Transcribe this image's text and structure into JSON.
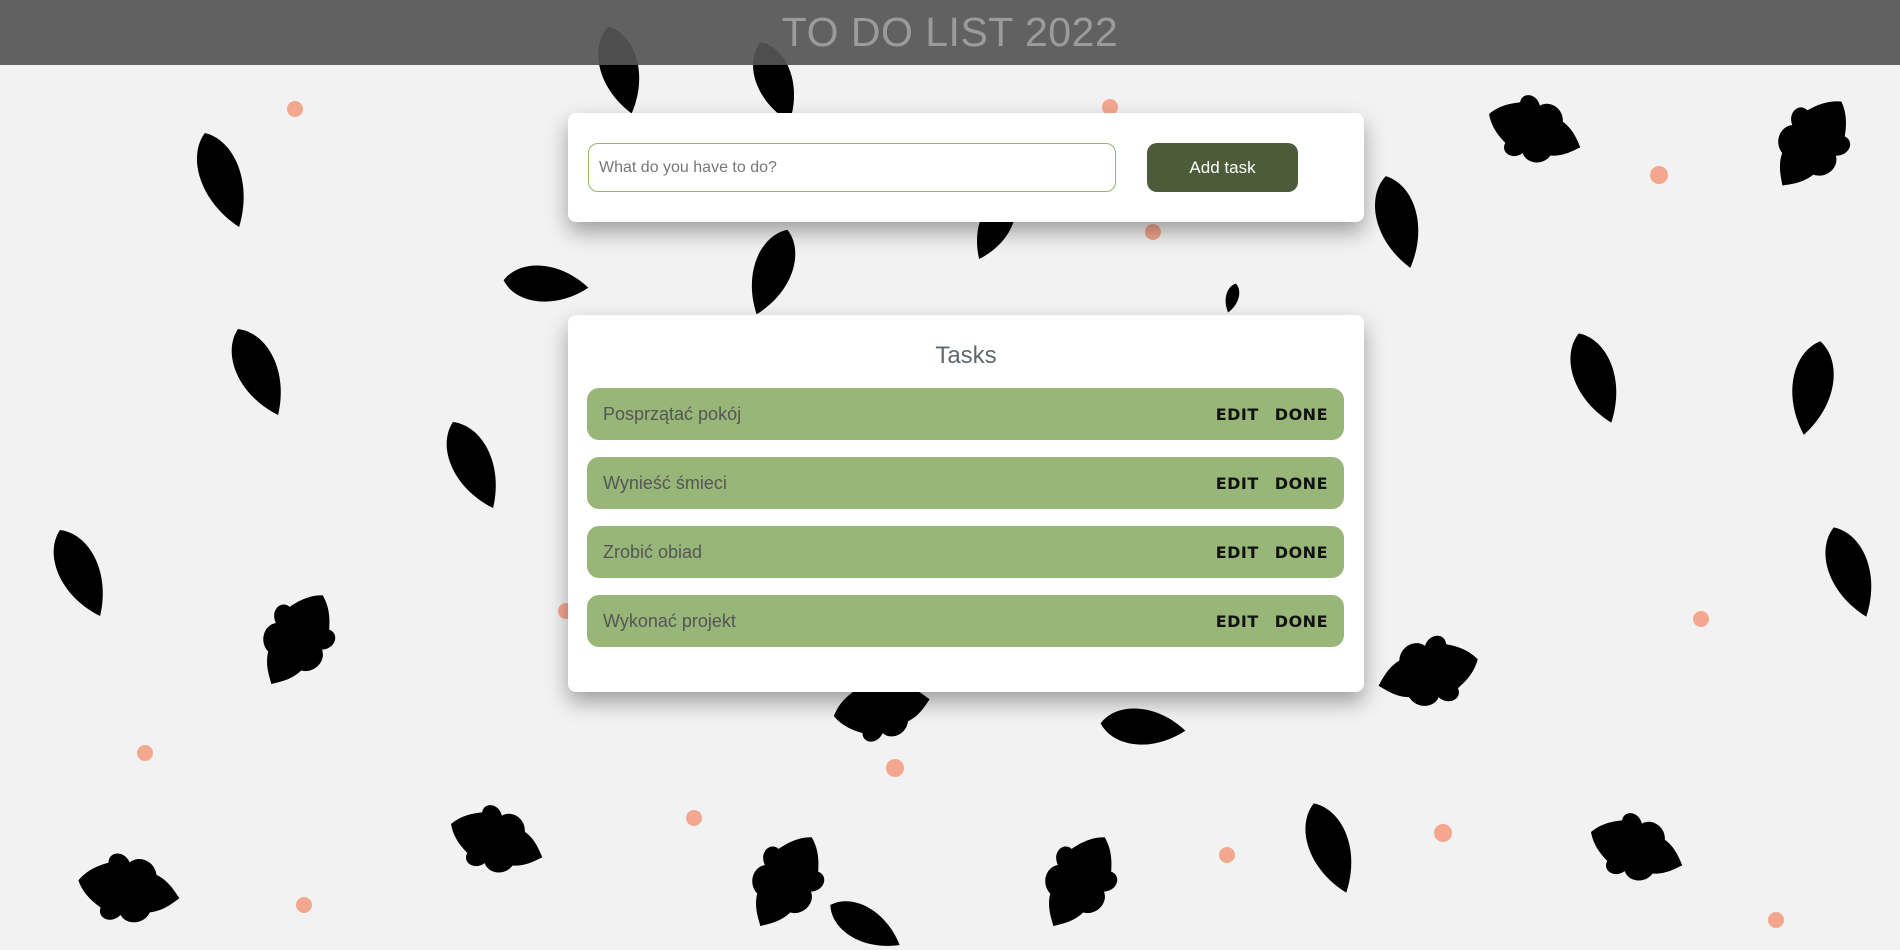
{
  "header": {
    "title": "TO DO LIST 2022"
  },
  "add_form": {
    "placeholder": "What do you have to do?",
    "value": "",
    "button_label": "Add task"
  },
  "tasks": {
    "heading": "Tasks",
    "items": [
      {
        "text": "Posprzątać pokój",
        "edit_label": "EDIT",
        "done_label": "DONE"
      },
      {
        "text": "Wynieść śmieci",
        "edit_label": "EDIT",
        "done_label": "DONE"
      },
      {
        "text": "Zrobić obiad",
        "edit_label": "EDIT",
        "done_label": "DONE"
      },
      {
        "text": "Wykonać projekt",
        "edit_label": "EDIT",
        "done_label": "DONE"
      }
    ]
  },
  "colors": {
    "background": "#f2f2f2",
    "header_bar": "#555555",
    "accent_dark_green": "#4c5b3a",
    "task_row_green": "#97b678",
    "leaf_dark": "#4a5e3a",
    "leaf_light": "#97b777",
    "dot_salmon": "#f4a78f"
  },
  "decor": {
    "background_icon": "leaf-pattern-icon"
  }
}
